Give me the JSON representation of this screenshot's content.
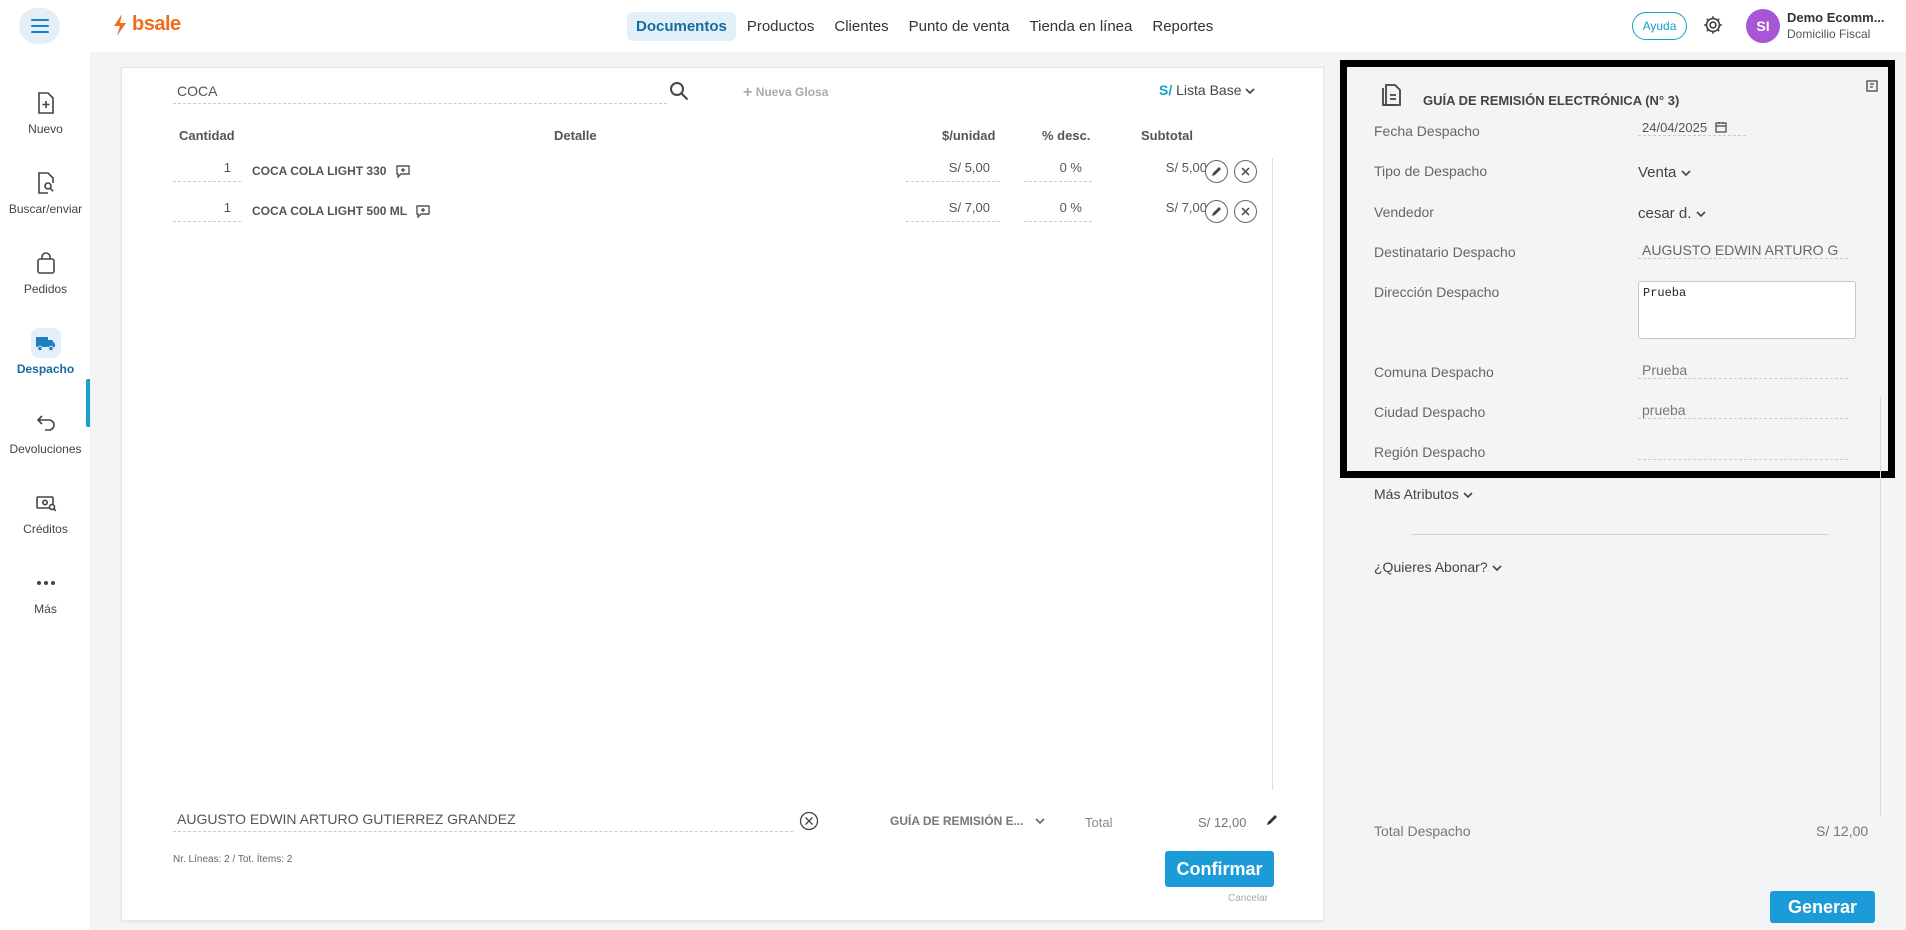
{
  "header": {
    "logo_text": "bsale",
    "nav": [
      "Documentos",
      "Productos",
      "Clientes",
      "Punto de venta",
      "Tienda en línea",
      "Reportes"
    ],
    "active_nav": "Documentos",
    "help_label": "Ayuda",
    "avatar_initials": "SI",
    "account_name": "Demo Ecomm...",
    "account_sub": "Domicilio Fiscal"
  },
  "sidebar": {
    "items": [
      {
        "label": "Nuevo",
        "icon": "file-plus-icon"
      },
      {
        "label": "Buscar/enviar",
        "icon": "file-search-icon"
      },
      {
        "label": "Pedidos",
        "icon": "bag-icon"
      },
      {
        "label": "Despacho",
        "icon": "truck-icon",
        "active": true
      },
      {
        "label": "Devoluciones",
        "icon": "return-icon"
      },
      {
        "label": "Créditos",
        "icon": "cash-search-icon"
      },
      {
        "label": "Más",
        "icon": "more-icon"
      }
    ]
  },
  "document": {
    "search_value": "COCA",
    "nueva_glosa": "Nueva Glosa",
    "currency_symbol": "S/",
    "price_list": "Lista Base",
    "columns": {
      "cantidad": "Cantidad",
      "detalle": "Detalle",
      "unidad": "$/unidad",
      "desc": "% desc.",
      "subtotal": "Subtotal"
    },
    "rows": [
      {
        "qty": "1",
        "product": "COCA COLA LIGHT 330",
        "price": "S/ 5,00",
        "discount": "0 %",
        "subtotal": "S/ 5,00"
      },
      {
        "qty": "1",
        "product": "COCA COLA LIGHT 500 ML",
        "price": "S/ 7,00",
        "discount": "0 %",
        "subtotal": "S/ 7,00"
      }
    ],
    "client": "AUGUSTO EDWIN ARTURO GUTIERREZ GRANDEZ",
    "doc_type": "GUÍA DE REMISIÓN E...",
    "total_label": "Total",
    "total_value": "S/ 12,00",
    "lines_info": "Nr. Líneas: 2 / Tot. Ítems: 2",
    "confirm_label": "Confirmar",
    "cancel_label": "Cancelar"
  },
  "guia": {
    "title": "GUÍA DE REMISIÓN ELECTRÓNICA (N° 3)",
    "fields": {
      "fecha_label": "Fecha Despacho",
      "fecha_value": "24/04/2025",
      "tipo_label": "Tipo de Despacho",
      "tipo_value": "Venta",
      "vendedor_label": "Vendedor",
      "vendedor_value": "cesar d.",
      "destinatario_label": "Destinatario Despacho",
      "destinatario_value": "AUGUSTO EDWIN ARTURO G",
      "direccion_label": "Dirección Despacho",
      "direccion_value": "Prueba",
      "comuna_label": "Comuna Despacho",
      "comuna_value": "Prueba",
      "ciudad_label": "Ciudad Despacho",
      "ciudad_value": "prueba",
      "region_label": "Región Despacho",
      "region_value": ""
    },
    "more_attributes": "Más Atributos",
    "abonar": "¿Quieres Abonar?",
    "total_label": "Total Despacho",
    "total_value": "S/ 12,00",
    "generar_label": "Generar"
  },
  "colors": {
    "brand": "#f26b1d",
    "accent": "#1b9bd7",
    "avatar": "#a855d6"
  }
}
